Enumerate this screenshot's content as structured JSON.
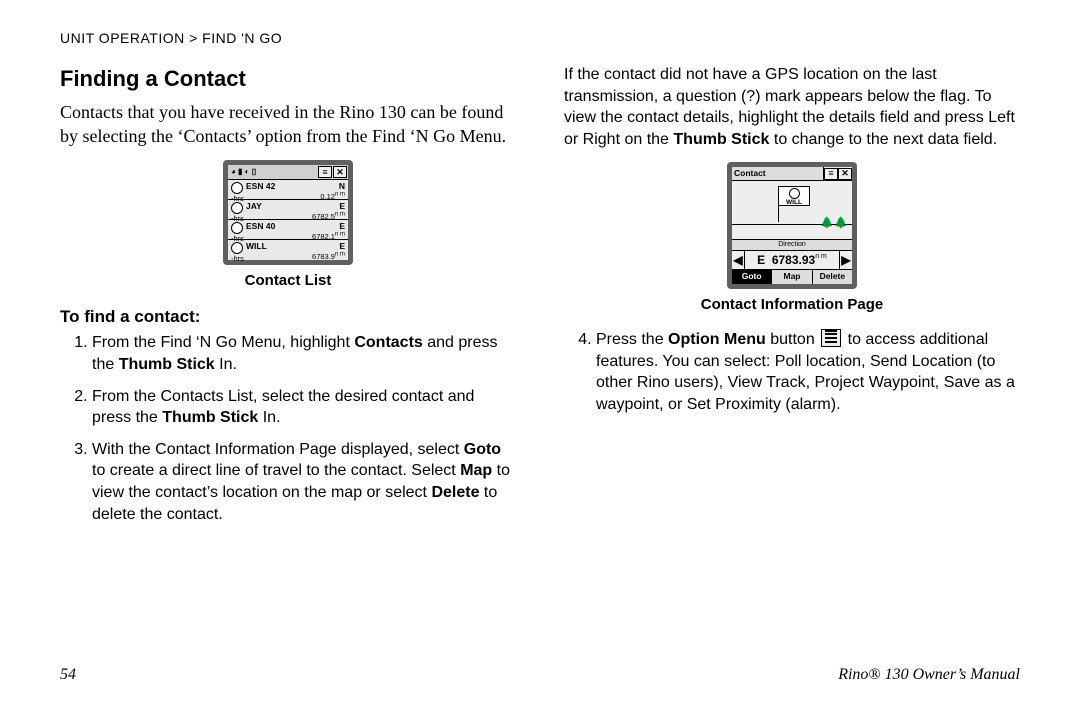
{
  "header": "UNIT OPERATION > FIND 'N GO",
  "heading": "Finding a Contact",
  "intro": "Contacts that you have received in the Rino 130 can be found by selecting the ‘Contacts’ option from the Find ‘N Go Menu.",
  "caption_left": "Contact List",
  "subhead": "To find a contact:",
  "steps_left": [
    {
      "pre": "From the Find ‘N Go Menu, highlight ",
      "b1": "Contacts",
      "mid": " and press the ",
      "b2": "Thumb Stick",
      "post": " In."
    },
    {
      "pre": "From the Contacts List, select the desired contact and press the ",
      "b1": "Thumb Stick",
      "mid": "",
      "b2": "",
      "post": " In."
    },
    {
      "pre": "With the Contact Information Page displayed, select ",
      "b1": "Goto",
      "mid": " to create a direct line of travel to the contact. Select ",
      "b2": "Map",
      "post_mid": " to view the contact’s location on the map or select ",
      "b3": "Delete",
      "post": " to delete the contact."
    }
  ],
  "right_top": {
    "pre": "If the contact did not have a GPS location on the last transmission, a question (?) mark appears below the flag. To view the contact details, highlight the details field and press Left or Right on the ",
    "b": "Thumb Stick",
    "post": " to change to the next data field."
  },
  "caption_right": "Contact Information Page",
  "step4": {
    "num": "4.",
    "pre": "Press the ",
    "b": "Option Menu",
    "mid": " button ",
    "post": " to access additional features. You can select: Poll location, Send Location (to other Rino users), View Track, Project Waypoint, Save as a waypoint, or Set Proximity (alarm)."
  },
  "contact_list": [
    {
      "name": "ESN 42",
      "sub": "-hrs",
      "dir": "N",
      "dist": "0.12",
      "u": "n m"
    },
    {
      "name": "JAY",
      "sub": "-hrs",
      "dir": "E",
      "dist": "6782.5",
      "u": "n m"
    },
    {
      "name": "ESN 40",
      "sub": "-hrs",
      "dir": "E",
      "dist": "6782.1",
      "u": "n m"
    },
    {
      "name": "WILL",
      "sub": "-hrs",
      "dir": "E",
      "dist": "6783.9",
      "u": "n m"
    }
  ],
  "contact_page": {
    "title": "Contact",
    "flag_name": "WILL",
    "dir_label": "Direction",
    "dir_letter": "E",
    "dir_value": "6783.93",
    "dir_unit": "n m",
    "buttons": [
      "Goto",
      "Map",
      "Delete"
    ],
    "selected": 0
  },
  "footer_left": "54",
  "footer_right": "Rino® 130 Owner’s Manual"
}
